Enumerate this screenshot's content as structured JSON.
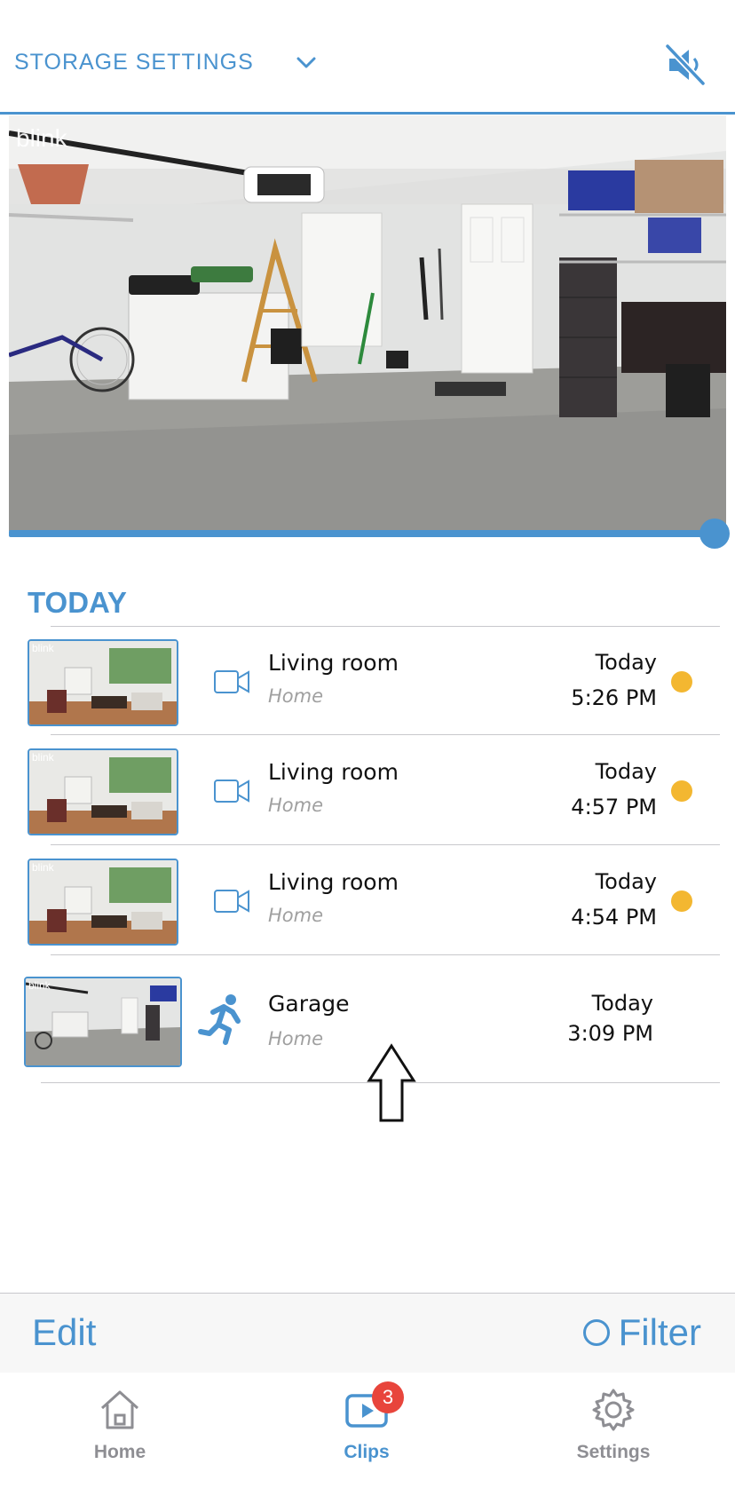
{
  "header": {
    "storage_label": "STORAGE SETTINGS",
    "storage_icon": "chevron-down-icon",
    "mute_icon": "speaker-muted-icon"
  },
  "player": {
    "watermark": "blink",
    "progress": 1.0
  },
  "section": {
    "title": "TODAY"
  },
  "clips": [
    {
      "watermark": "blink",
      "icon": "video-camera-icon",
      "title": "Living room",
      "subtitle": "Home",
      "date": "Today",
      "time": "5:26 PM",
      "unread": true
    },
    {
      "watermark": "blink",
      "icon": "video-camera-icon",
      "title": "Living room",
      "subtitle": "Home",
      "date": "Today",
      "time": "4:57 PM",
      "unread": true
    },
    {
      "watermark": "blink",
      "icon": "video-camera-icon",
      "title": "Living room",
      "subtitle": "Home",
      "date": "Today",
      "time": "4:54 PM",
      "unread": true
    },
    {
      "watermark": "blink",
      "icon": "motion-running-icon",
      "title": "Garage",
      "subtitle": "Home",
      "date": "Today",
      "time": "3:09 PM",
      "unread": false
    }
  ],
  "actions": {
    "edit": "Edit",
    "filter": "Filter"
  },
  "tabs": [
    {
      "label": "Home",
      "icon": "home-icon",
      "active": false
    },
    {
      "label": "Clips",
      "icon": "play-icon",
      "active": true,
      "badge": "3"
    },
    {
      "label": "Settings",
      "icon": "gear-icon",
      "active": false
    }
  ],
  "colors": {
    "accent": "#4a93cf",
    "unread_dot": "#f3b731",
    "badge": "#e8453c",
    "inactive_tab": "#8e8e93"
  }
}
